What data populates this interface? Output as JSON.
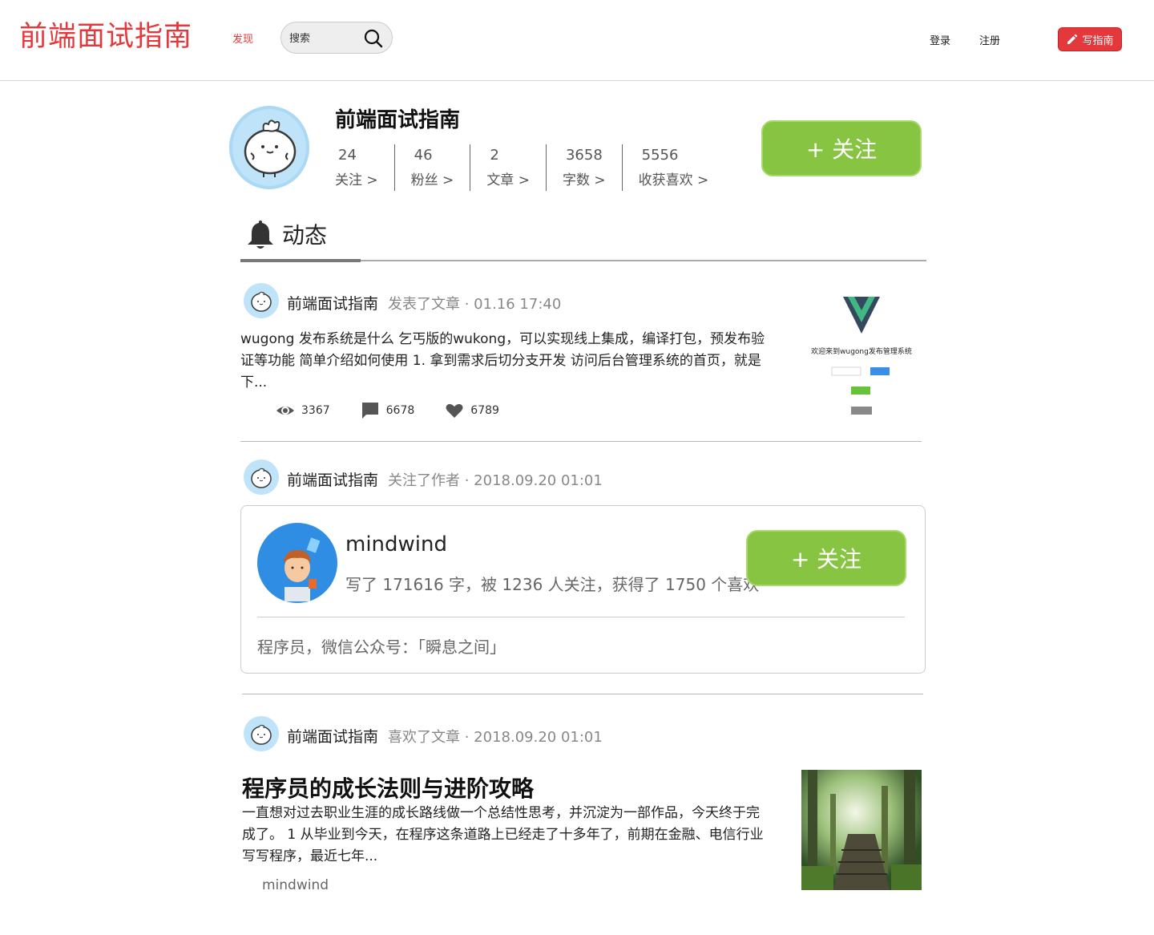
{
  "header": {
    "logo": "前端面试指南",
    "discover": "发现",
    "search_placeholder": "搜索",
    "login": "登录",
    "register": "注册",
    "write": "写指南"
  },
  "profile": {
    "name": "前端面试指南",
    "stats": [
      {
        "value": "24",
        "label": "关注 >"
      },
      {
        "value": "46",
        "label": "粉丝 >"
      },
      {
        "value": "2",
        "label": "文章 >"
      },
      {
        "value": "3658",
        "label": "字数 >"
      },
      {
        "value": "5556",
        "label": "收获喜欢 >"
      }
    ],
    "follow": "+ 关注"
  },
  "tab": {
    "label": "动态"
  },
  "feed": [
    {
      "author": "前端面试指南",
      "action": "发表了文章 · 01.16 17:40",
      "summary": "wugong 发布系统是什么 乞丐版的wukong，可以实现线上集成，编译打包，预发布验证等功能 简单介绍如何使用 1. 拿到需求后切分支开发 访问后台管理系统的首页，就是下...",
      "views": "3367",
      "comments": "6678",
      "likes": "6789",
      "thumb_text": "欢迎来到wugong发布管理系统"
    },
    {
      "author": "前端面试指南",
      "action": "关注了作者 · 2018.09.20 01:01",
      "card": {
        "name": "mindwind",
        "stats": "写了 171616 字，被 1236 人关注，获得了 1750 个喜欢",
        "follow": "+ 关注",
        "bio": "程序员，微信公众号：「瞬息之间」"
      }
    },
    {
      "author": "前端面试指南",
      "action": "喜欢了文章 · 2018.09.20 01:01",
      "title": "程序员的成长法则与进阶攻略",
      "summary": "一直想对过去职业生涯的成长路线做一个总结性思考，并沉淀为一部作品，今天终于完成了。 1 从毕业到今天，在程序这条道路上已经走了十多年了，前期在金融、电信行业写写程序，最近七年...",
      "article_author": "mindwind"
    }
  ],
  "colors": {
    "brand_red": "#e4393c",
    "follow_green": "#86c441"
  }
}
